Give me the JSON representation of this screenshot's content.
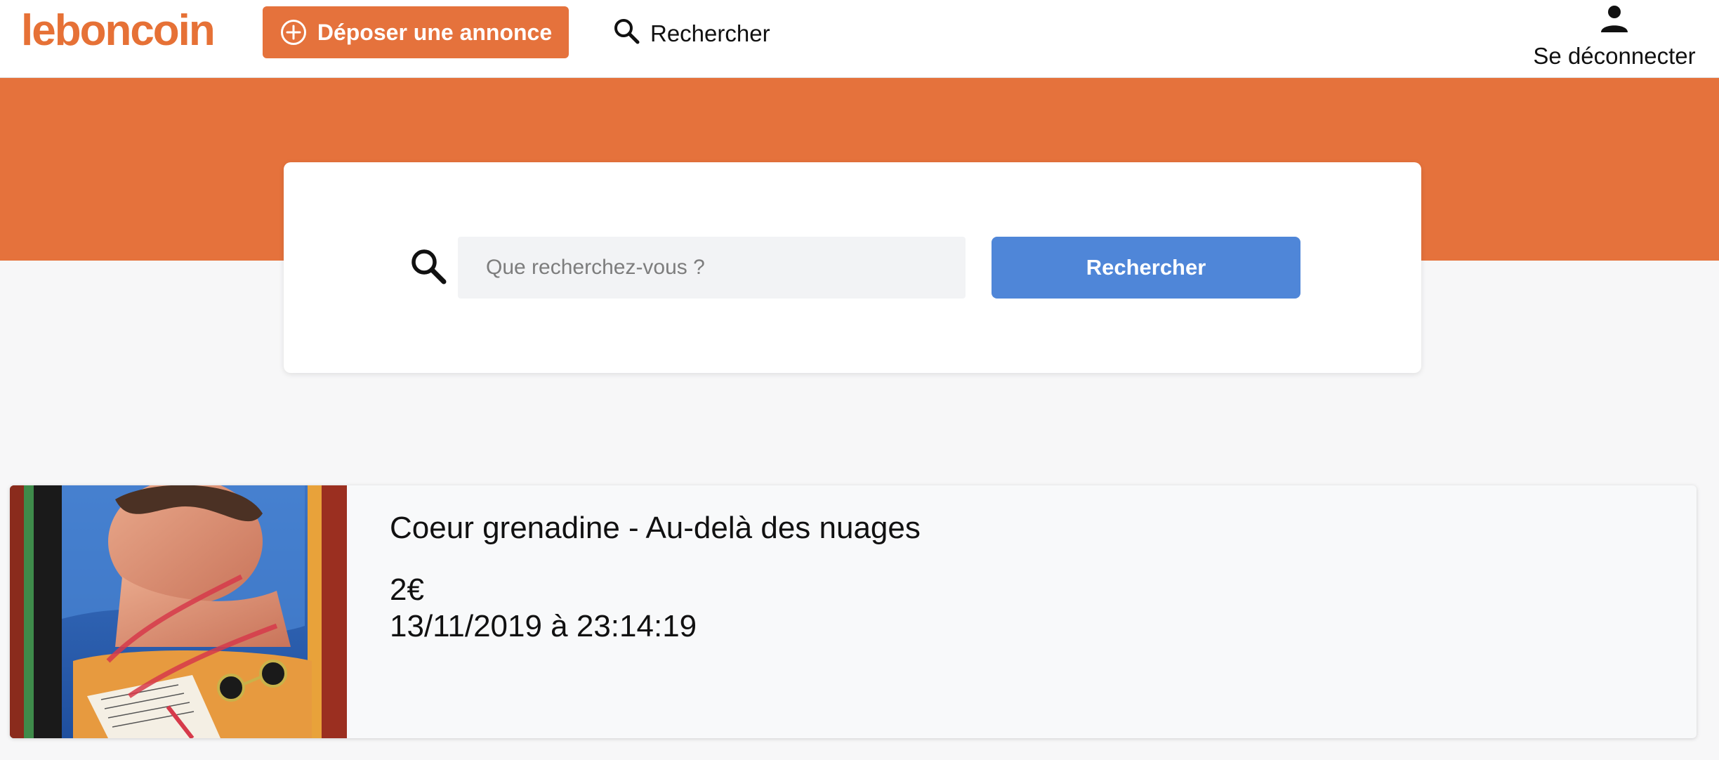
{
  "header": {
    "logo": "leboncoin",
    "post_ad_label": "Déposer une annonce",
    "search_label": "Rechercher",
    "logout_label": "Se déconnecter"
  },
  "search": {
    "placeholder": "Que recherchez-vous ?",
    "value": "",
    "button_label": "Rechercher"
  },
  "listings": [
    {
      "title": "Coeur grenadine - Au-delà des nuages",
      "price": "2€",
      "date": "13/11/2019 à 23:14:19"
    }
  ],
  "colors": {
    "brand": "#e5723c",
    "button_blue": "#4f86d8",
    "page_bg": "#f7f7f8"
  },
  "icons": {
    "post": "plus-circle-icon",
    "search": "search-icon",
    "user": "user-icon"
  }
}
